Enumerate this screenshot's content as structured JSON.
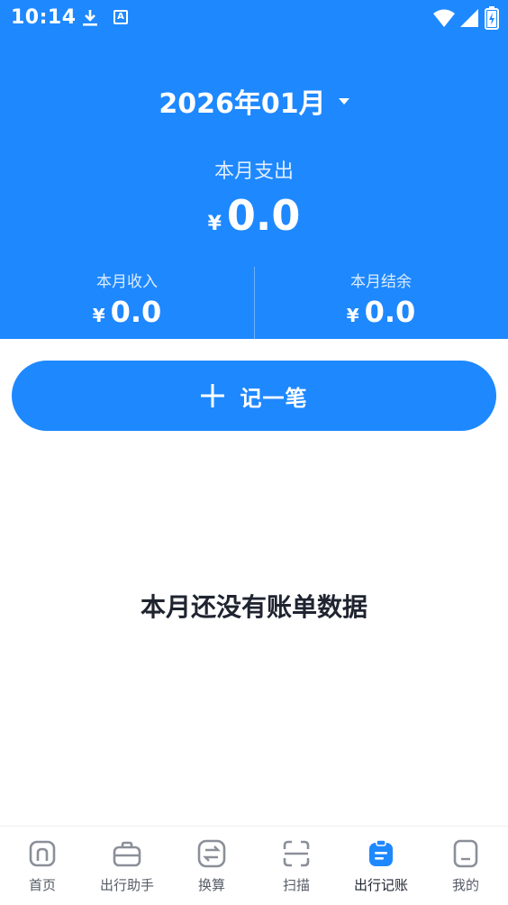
{
  "status_bar": {
    "time": "10:14",
    "keyboard_badge": "A"
  },
  "header": {
    "month": "2026年01月",
    "expense_label": "本月支出",
    "currency": "¥",
    "expense_amount": "0.0",
    "income_label": "本月收入",
    "income_amount": "0.0",
    "balance_label": "本月结余",
    "balance_amount": "0.0"
  },
  "record_button": {
    "label": "记一笔"
  },
  "empty_state": {
    "text": "本月还没有账单数据"
  },
  "tabbar": {
    "items": [
      {
        "label": "首页",
        "icon": "home-icon"
      },
      {
        "label": "出行助手",
        "icon": "briefcase-icon"
      },
      {
        "label": "换算",
        "icon": "exchange-icon"
      },
      {
        "label": "扫描",
        "icon": "scan-icon"
      },
      {
        "label": "出行记账",
        "icon": "ledger-icon",
        "active": true
      },
      {
        "label": "我的",
        "icon": "profile-icon"
      }
    ]
  },
  "colors": {
    "accent": "#1E88FF",
    "tab_inactive": "#8A8F99",
    "text_dark": "#1F2430"
  }
}
